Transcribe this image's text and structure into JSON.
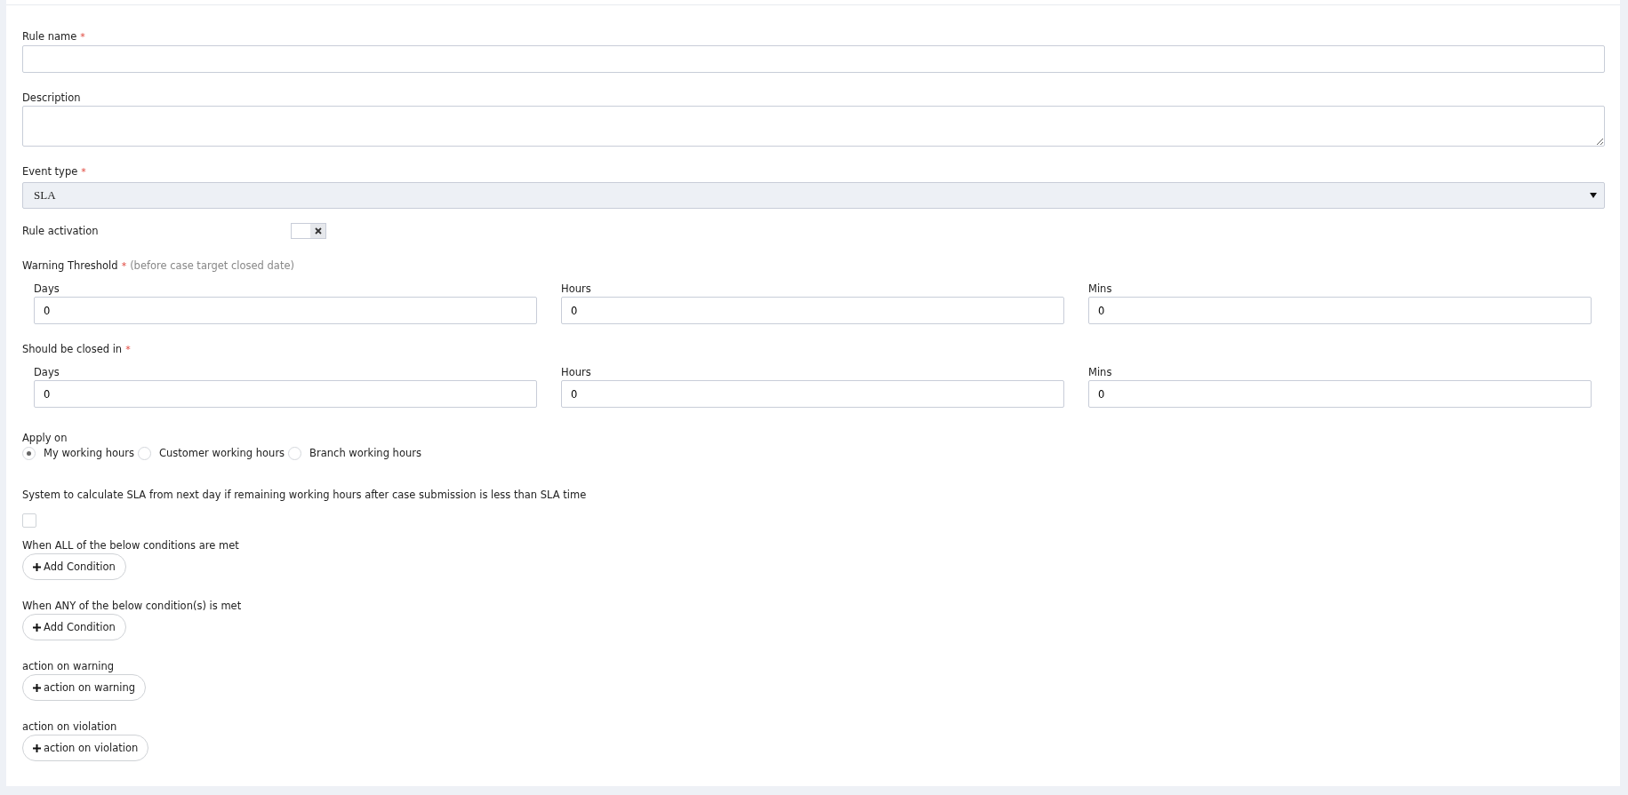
{
  "fields": [
    {
      "kind": "input",
      "label": "Rule name",
      "required_mark": "*"
    },
    {
      "kind": "textarea",
      "label": "Description"
    },
    {
      "kind": "select",
      "label": "Event type",
      "required_mark": "*",
      "value": "SLA"
    }
  ],
  "rule_activation": {
    "label": "Rule activation",
    "on": false
  },
  "durations": [
    {
      "label": "Warning Threshold",
      "required_mark": "*",
      "note": "(before case target closed date)",
      "parts": [
        {
          "label": "Days",
          "value": "0"
        },
        {
          "label": "Hours",
          "value": "0"
        },
        {
          "label": "Mins",
          "value": "0"
        }
      ]
    },
    {
      "label": "Should be closed in",
      "required_mark": "*",
      "parts": [
        {
          "label": "Days",
          "value": "0"
        },
        {
          "label": "Hours",
          "value": "0"
        },
        {
          "label": "Mins",
          "value": "0"
        }
      ]
    }
  ],
  "apply_on": {
    "label": "Apply on",
    "options": [
      {
        "label": "My working hours",
        "selected": true
      },
      {
        "label": "Customer working hours",
        "selected": false
      },
      {
        "label": "Branch working hours",
        "selected": false
      }
    ]
  },
  "next_day": {
    "label": "System to calculate SLA from next day if remaining working hours after case submission is less than SLA time",
    "checked": false
  },
  "sections": [
    {
      "label": "When ALL of the below conditions are met",
      "button": "Add Condition"
    },
    {
      "label": "When ANY of the below condition(s) is met",
      "button": "Add Condition"
    },
    {
      "label": "action on warning",
      "button": "action on warning"
    },
    {
      "label": "action on violation",
      "button": "action on violation"
    }
  ]
}
